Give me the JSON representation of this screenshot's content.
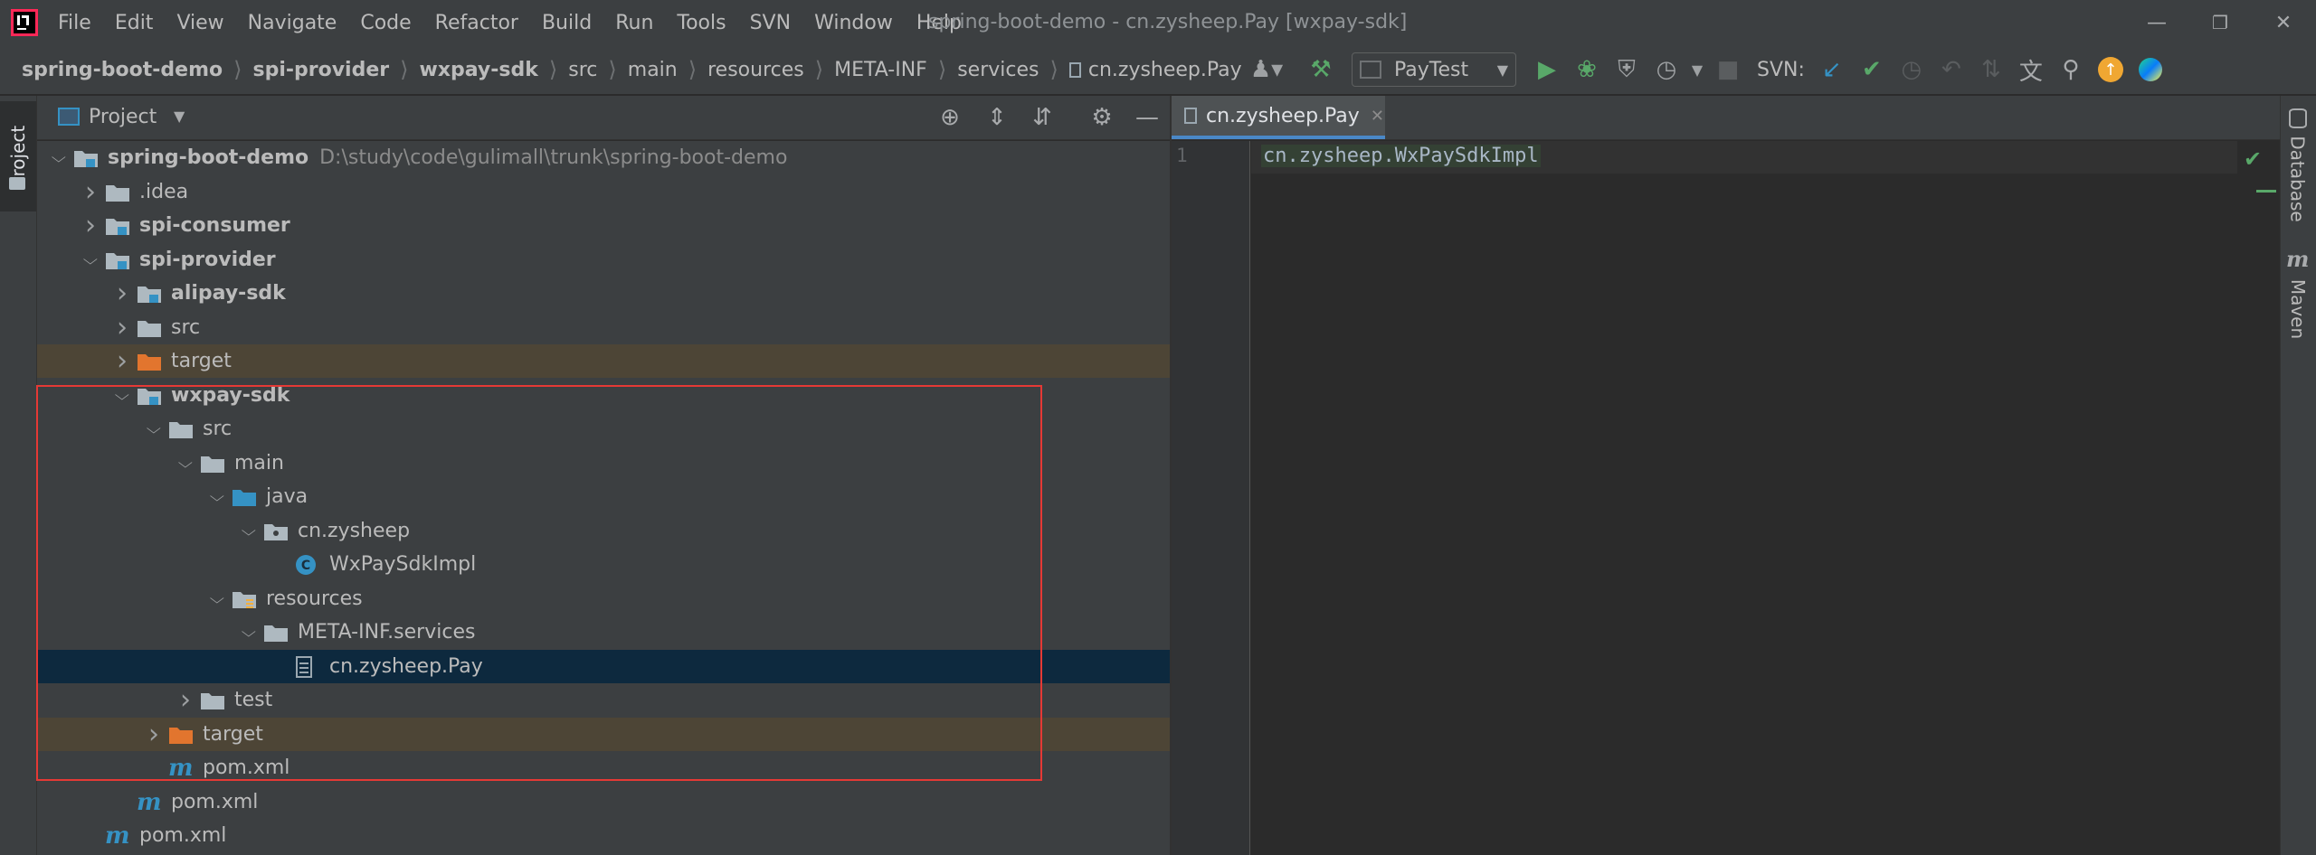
{
  "menu": [
    "File",
    "Edit",
    "View",
    "Navigate",
    "Code",
    "Refactor",
    "Build",
    "Run",
    "Tools",
    "SVN",
    "Window",
    "Help"
  ],
  "window_title": "spring-boot-demo - cn.zysheep.Pay [wxpay-sdk]",
  "breadcrumb": [
    {
      "label": "spring-boot-demo",
      "bold": true
    },
    {
      "label": "spi-provider",
      "bold": true
    },
    {
      "label": "wxpay-sdk",
      "bold": true
    },
    {
      "label": "src",
      "bold": false
    },
    {
      "label": "main",
      "bold": false
    },
    {
      "label": "resources",
      "bold": false
    },
    {
      "label": "META-INF",
      "bold": false
    },
    {
      "label": "services",
      "bold": false
    },
    {
      "label": "cn.zysheep.Pay",
      "bold": false
    }
  ],
  "toolbar": {
    "run_config": "PayTest",
    "svn_label": "SVN:"
  },
  "project_panel": {
    "title": "Project",
    "stripe_label": "Project",
    "tree": [
      {
        "label": "spring-boot-demo",
        "path": "D:\\study\\code\\gulimall\\trunk\\spring-boot-demo",
        "depth": 0,
        "expander": "open",
        "icon": "module-folder-icon",
        "bold": true
      },
      {
        "label": ".idea",
        "depth": 1,
        "expander": "closed",
        "icon": "folder-icon",
        "bold": false
      },
      {
        "label": "spi-consumer",
        "depth": 1,
        "expander": "closed",
        "icon": "module-folder-icon",
        "bold": true
      },
      {
        "label": "spi-provider",
        "depth": 1,
        "expander": "open",
        "icon": "module-folder-icon",
        "bold": true
      },
      {
        "label": "alipay-sdk",
        "depth": 2,
        "expander": "closed",
        "icon": "module-folder-icon",
        "bold": true
      },
      {
        "label": "src",
        "depth": 2,
        "expander": "closed",
        "icon": "folder-icon",
        "bold": false
      },
      {
        "label": "target",
        "depth": 2,
        "expander": "closed",
        "icon": "excluded-folder-icon",
        "bold": false,
        "excluded": true
      },
      {
        "label": "wxpay-sdk",
        "depth": 2,
        "expander": "open",
        "icon": "module-folder-icon",
        "bold": true
      },
      {
        "label": "src",
        "depth": 3,
        "expander": "open",
        "icon": "folder-icon",
        "bold": false
      },
      {
        "label": "main",
        "depth": 4,
        "expander": "open",
        "icon": "folder-icon",
        "bold": false
      },
      {
        "label": "java",
        "depth": 5,
        "expander": "open",
        "icon": "source-folder-icon",
        "bold": false
      },
      {
        "label": "cn.zysheep",
        "depth": 6,
        "expander": "open",
        "icon": "package-icon",
        "bold": false
      },
      {
        "label": "WxPaySdkImpl",
        "depth": 7,
        "expander": "none",
        "icon": "class-icon",
        "bold": false
      },
      {
        "label": "resources",
        "depth": 5,
        "expander": "open",
        "icon": "resources-folder-icon",
        "bold": false
      },
      {
        "label": "META-INF.services",
        "depth": 6,
        "expander": "open",
        "icon": "folder-icon",
        "bold": false
      },
      {
        "label": "cn.zysheep.Pay",
        "depth": 7,
        "expander": "none",
        "icon": "text-file-icon",
        "bold": false,
        "selected": true
      },
      {
        "label": "test",
        "depth": 4,
        "expander": "closed",
        "icon": "folder-icon",
        "bold": false
      },
      {
        "label": "target",
        "depth": 3,
        "expander": "closed",
        "icon": "excluded-folder-icon",
        "bold": false,
        "excluded": true
      },
      {
        "label": "pom.xml",
        "depth": 3,
        "expander": "none",
        "icon": "maven-icon",
        "bold": false
      },
      {
        "label": "pom.xml",
        "depth": 2,
        "expander": "none",
        "icon": "maven-icon",
        "bold": false
      },
      {
        "label": "pom.xml",
        "depth": 1,
        "expander": "none",
        "icon": "maven-icon",
        "bold": false
      }
    ]
  },
  "editor": {
    "tab_label": "cn.zysheep.Pay",
    "line_number": "1",
    "code": "cn.zysheep.WxPaySdkImpl"
  },
  "right_stripe": {
    "database_label": "Database",
    "maven_label": "Maven"
  },
  "colors": {
    "highlight_box": "#e53935",
    "selection": "#0d293e",
    "excluded_row": "#4d4536",
    "accent_tab": "#4a88c7"
  }
}
